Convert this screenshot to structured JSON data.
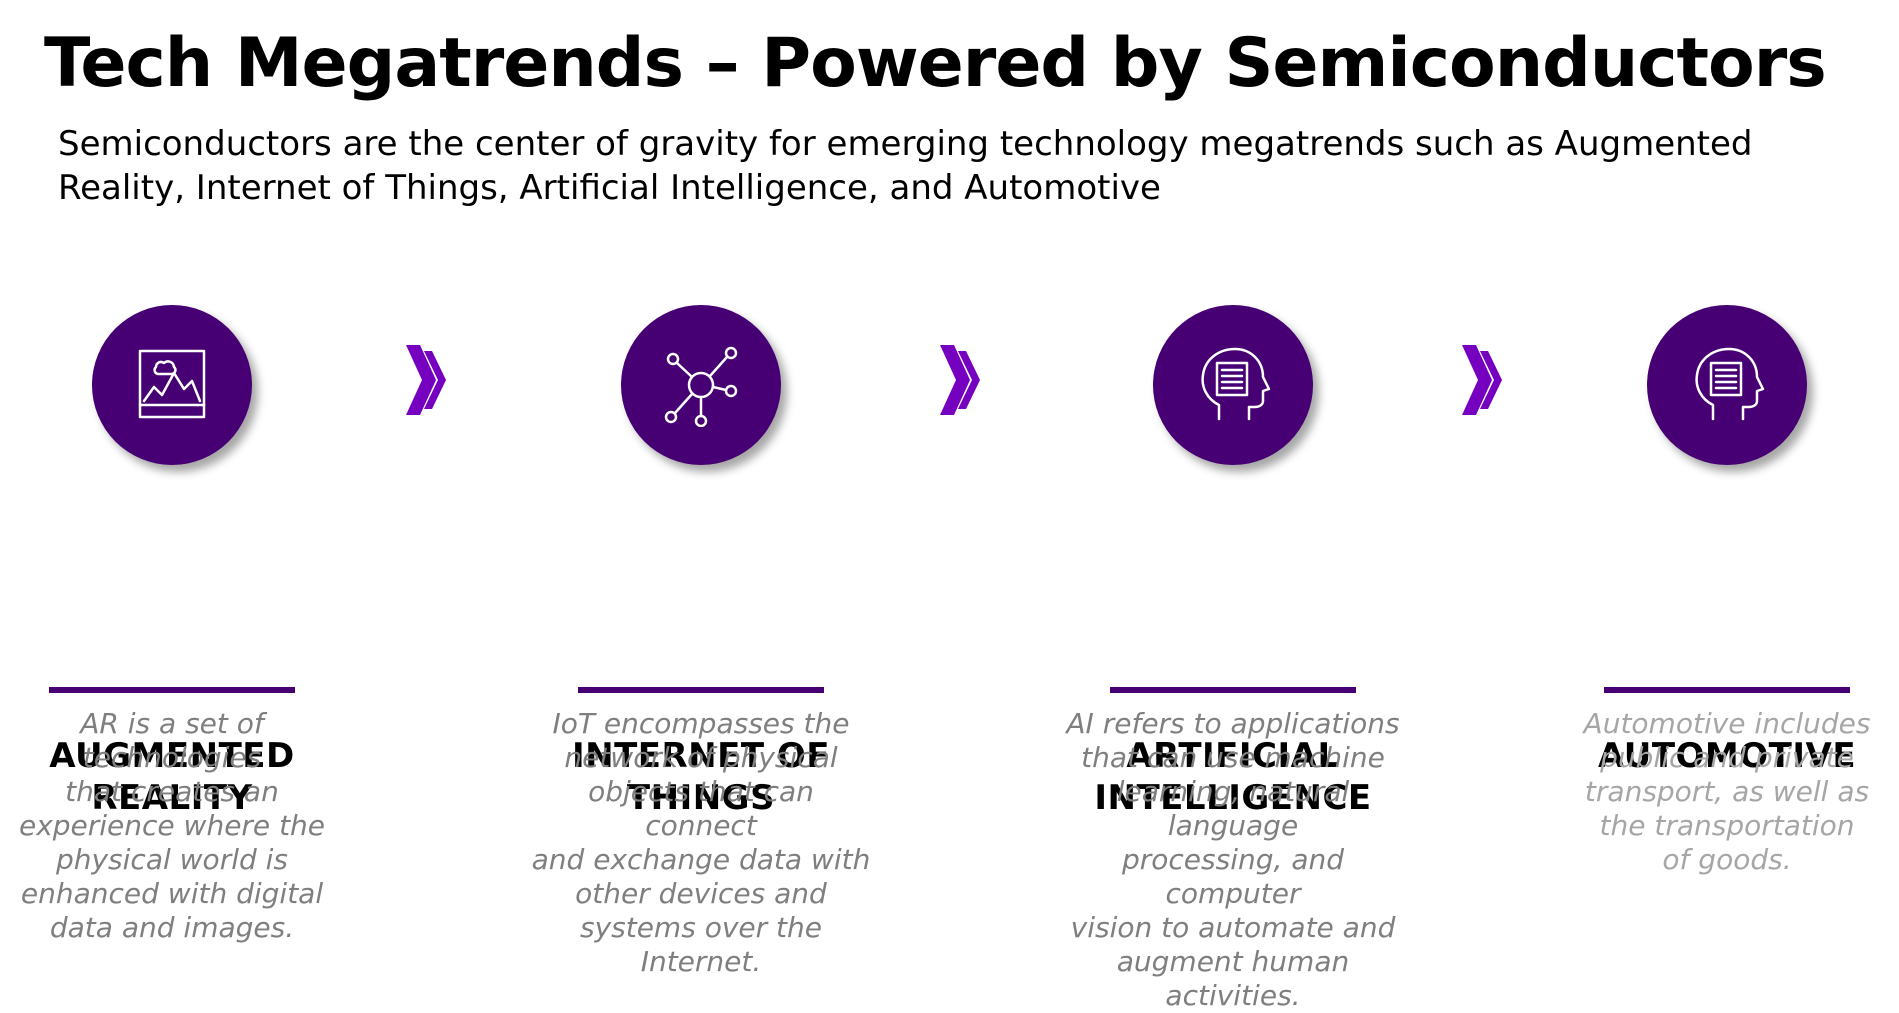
{
  "title": "Tech Megatrends – Powered by Semiconductors",
  "subtitle": "Semiconductors are the center of gravity for emerging technology megatrends such as Augmented Reality, Internet of Things, Artificial Intelligence, and Automotive",
  "colors": {
    "accent": "#460073",
    "arrow": "#7500C0",
    "description": "#7f7f7f",
    "description_light": "#a6a6a6"
  },
  "trends": [
    {
      "icon": "image-landscape-icon",
      "heading": "AUGMENTED\nREALITY",
      "description": "AR is a set of\ntechnologies\nthat creates an\nexperience where the\nphysical world is\nenhanced with digital\ndata and images."
    },
    {
      "icon": "network-nodes-icon",
      "heading": "INTERNET OF\nTHINGS",
      "description": "IoT encompasses the\nnetwork of physical\nobjects that can connect\nand exchange data with\nother devices and\nsystems over the Internet."
    },
    {
      "icon": "head-document-icon",
      "heading": "ARTIFICIAL\nINTELLIGENCE",
      "description": "AI refers to applications\nthat can use machine\nlearning, natural language\nprocessing, and computer\nvision to automate and\naugment human activities."
    },
    {
      "icon": "head-document-icon",
      "heading": "AUTOMOTIVE",
      "description": "Automotive includes\npublic and private\ntransport, as well as\nthe transportation\nof goods."
    }
  ]
}
